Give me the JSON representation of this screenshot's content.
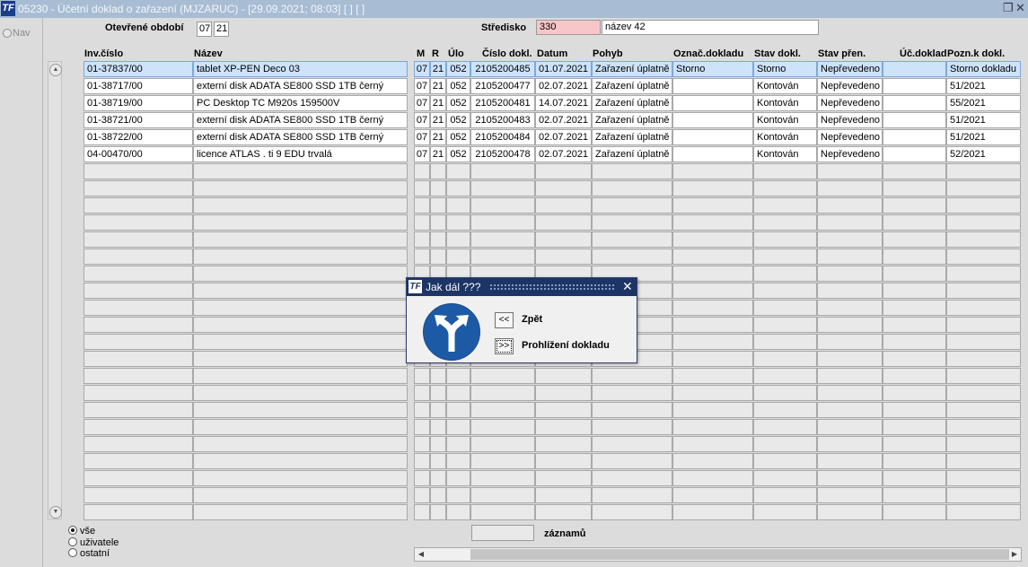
{
  "window": {
    "title": "05230 - Účetní doklad o zařazení (MJZARUC) - [29.09.2021; 08:03]  [ ]  [ ]",
    "logo": "TF",
    "restore_icon": "restore-icon",
    "close_icon": "close-icon"
  },
  "nav": {
    "label": "Nav"
  },
  "header": {
    "period_label": "Otevřené období",
    "period_month": "07",
    "period_year": "21",
    "center_label": "Středisko",
    "center_code": "330",
    "center_name": "název 42"
  },
  "table": {
    "columns": [
      "Inv.číslo",
      "Název",
      "M",
      "R",
      "Úlo",
      "Číslo dokl.",
      "Datum",
      "Pohyb",
      "Označ.dokladu",
      "Stav dokl.",
      "Stav přen.",
      "Úč.doklad",
      "Pozn.k dokl."
    ],
    "rows": [
      [
        "01-37837/00",
        "tablet XP-PEN Deco 03",
        "07",
        "21",
        "052",
        "2105200485",
        "01.07.2021",
        "Zařazení úplatně",
        "Storno",
        "Storno",
        "Nepřevedeno",
        "",
        "Storno dokladu"
      ],
      [
        "01-38717/00",
        "externí disk ADATA SE800 SSD 1TB černý",
        "07",
        "21",
        "052",
        "2105200477",
        "02.07.2021",
        "Zařazení úplatně",
        "",
        "Kontován",
        "Nepřevedeno",
        "",
        "51/2021"
      ],
      [
        "01-38719/00",
        "PC Desktop TC M920s 159500V",
        "07",
        "21",
        "052",
        "2105200481",
        "14.07.2021",
        "Zařazení úplatně",
        "",
        "Kontován",
        "Nepřevedeno",
        "",
        "55/2021"
      ],
      [
        "01-38721/00",
        "externí disk ADATA SE800 SSD 1TB černý",
        "07",
        "21",
        "052",
        "2105200483",
        "02.07.2021",
        "Zařazení úplatně",
        "",
        "Kontován",
        "Nepřevedeno",
        "",
        "51/2021"
      ],
      [
        "01-38722/00",
        "externí disk ADATA SE800 SSD 1TB černý",
        "07",
        "21",
        "052",
        "2105200484",
        "02.07.2021",
        "Zařazení úplatně",
        "",
        "Kontován",
        "Nepřevedeno",
        "",
        "51/2021"
      ],
      [
        "04-00470/00",
        "licence ATLAS . ti 9 EDU trvalá",
        "07",
        "21",
        "052",
        "2105200478",
        "02.07.2021",
        "Zařazení úplatně",
        "",
        "Kontován",
        "Nepřevedeno",
        "",
        "52/2021"
      ]
    ]
  },
  "filter": {
    "options": [
      "vše",
      "uživatele",
      "ostatní"
    ],
    "selected": "vše"
  },
  "footer": {
    "records_label": "záznamů",
    "records_value": ""
  },
  "dialog": {
    "title": "Jak dál ???",
    "icon": "fork-arrow-icon",
    "back_key": "<<",
    "back_label": "Zpět",
    "forward_key": ">>",
    "forward_label": "Prohlížení dokladu"
  },
  "colors": {
    "titlebar": "#a8bcd4",
    "dialog_title": "#1d3466",
    "selected_row": "#cde3fa",
    "center_code_bg": "#f7c6c9"
  }
}
